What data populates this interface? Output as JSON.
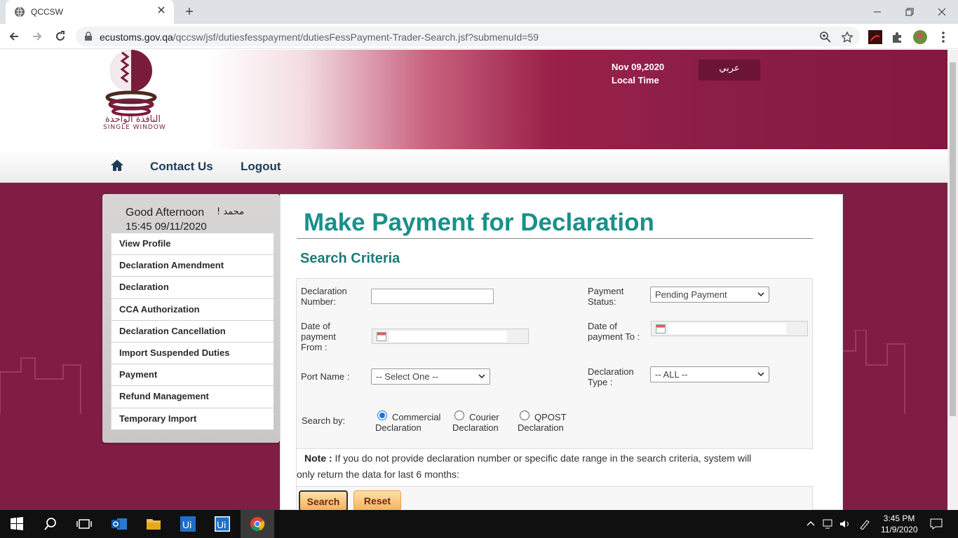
{
  "browser": {
    "tab_title": "QCCSW",
    "new_tab_symbol": "+",
    "tab_close_symbol": "✕",
    "url_host": "ecustoms.gov.qa",
    "url_path": "/qccsw/jsf/dutiesfesspayment/dutiesFessPayment-Trader-Search.jsf?submenuId=59"
  },
  "header": {
    "logo_arabic": "النافذة الواحدة",
    "logo_english": "SINGLE WINDOW",
    "date": "Nov 09,2020",
    "time_label": "Local Time",
    "language_button": "عربي"
  },
  "nav": {
    "contact": "Contact Us",
    "logout": "Logout"
  },
  "sidebar": {
    "greeting": "Good Afternoon",
    "user_name": "محمد !",
    "login_time": "15:45 09/11/2020",
    "items": [
      {
        "label": "View Profile"
      },
      {
        "label": "Declaration Amendment"
      },
      {
        "label": "Declaration"
      },
      {
        "label": "CCA Authorization"
      },
      {
        "label": "Declaration Cancellation"
      },
      {
        "label": "Import Suspended Duties"
      },
      {
        "label": "Payment"
      },
      {
        "label": "Refund Management"
      },
      {
        "label": "Temporary Import"
      }
    ]
  },
  "main": {
    "title": "Make Payment for Declaration",
    "section": "Search Criteria",
    "form": {
      "declaration_number_label_1": "Declaration",
      "declaration_number_label_2": "Number:",
      "declaration_number_value": "",
      "payment_status_label_1": "Payment",
      "payment_status_label_2": "Status:",
      "payment_status_value": "Pending Payment",
      "date_from_label_1": "Date of",
      "date_from_label_2": "payment",
      "date_from_label_3": "From :",
      "date_to_label_1": "Date of",
      "date_to_label_2": "payment To :",
      "port_label": "Port Name :",
      "port_value": "-- Select One --",
      "decl_type_label_1": "Declaration",
      "decl_type_label_2": "Type :",
      "decl_type_value": "-- ALL --",
      "search_by_label": "Search by:",
      "radio_commercial_1": "Commercial",
      "radio_commercial_2": "Declaration",
      "radio_courier_1": "Courier",
      "radio_courier_2": "Declaration",
      "radio_qpost_1": "QPOST",
      "radio_qpost_2": "Declaration",
      "selected_search_by": "Commercial Declaration"
    },
    "note_label": "Note :",
    "note_text_1": " If you do not provide declaration number or specific date range in the search criteria, system will",
    "note_text_2": "only return the data for last 6 months:",
    "search_button": "Search",
    "reset_button": "Reset"
  },
  "taskbar": {
    "time": "3:45 PM",
    "date": "11/9/2020"
  },
  "colors": {
    "banner_maroon": "#8b1e46",
    "title_teal": "#19908b",
    "button_orange": "#f6b25b"
  }
}
